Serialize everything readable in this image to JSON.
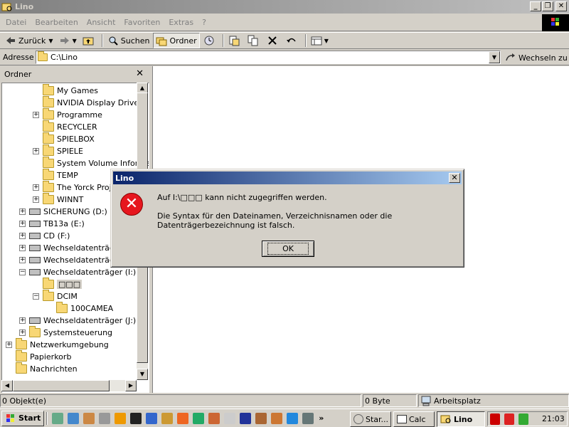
{
  "window": {
    "title": "Lino",
    "minimize": "_",
    "restore": "❐",
    "close": "✕"
  },
  "menu": [
    "Datei",
    "Bearbeiten",
    "Ansicht",
    "Favoriten",
    "Extras",
    "?"
  ],
  "toolbar": {
    "back": "Zurück",
    "search": "Suchen",
    "folders": "Ordner"
  },
  "address": {
    "label": "Adresse",
    "value": "C:\\Lino",
    "go": "Wechseln zu"
  },
  "folder_pane": {
    "title": "Ordner",
    "items": [
      {
        "label": "My Games",
        "expander": ""
      },
      {
        "label": "NVIDIA Display Driver",
        "expander": ""
      },
      {
        "label": "Programme",
        "expander": "+"
      },
      {
        "label": "RECYCLER",
        "expander": ""
      },
      {
        "label": "SPIELBOX",
        "expander": ""
      },
      {
        "label": "SPIELE",
        "expander": "+"
      },
      {
        "label": "System Volume Informa",
        "expander": ""
      },
      {
        "label": "TEMP",
        "expander": ""
      },
      {
        "label": "The Yorck Proje",
        "expander": "+"
      },
      {
        "label": "WINNT",
        "expander": "+"
      },
      {
        "label": "SICHERUNG (D:)",
        "expander": "+"
      },
      {
        "label": "TB13a (E:)",
        "expander": "+"
      },
      {
        "label": "CD (F:)",
        "expander": "+"
      },
      {
        "label": "Wechseldatenträge",
        "expander": "+"
      },
      {
        "label": "Wechseldatenträge",
        "expander": "+"
      },
      {
        "label": "Wechseldatenträger (I:)",
        "expander": "−"
      },
      {
        "label": "□□□",
        "expander": ""
      },
      {
        "label": "DCIM",
        "expander": "−"
      },
      {
        "label": "100CAMEA",
        "expander": ""
      },
      {
        "label": "Wechseldatenträger (J:)",
        "expander": "+"
      },
      {
        "label": "Systemsteuerung",
        "expander": "+"
      },
      {
        "label": "Netzwerkumgebung",
        "expander": "+"
      },
      {
        "label": "Papierkorb",
        "expander": ""
      },
      {
        "label": "Nachrichten",
        "expander": ""
      }
    ]
  },
  "status": {
    "objects": "0 Objekt(e)",
    "size": "0 Byte",
    "location": "Arbeitsplatz"
  },
  "taskbar": {
    "start": "Start",
    "tasks": [
      "Star...",
      "Calc",
      "Lino"
    ],
    "clock": "21:03"
  },
  "dialog": {
    "title": "Lino",
    "message": "Auf I:\\□□□ kann nicht zugegriffen werden.",
    "detail": "Die Syntax für den Dateinamen, Verzeichnisnamen oder die Datenträgerbezeichnung ist falsch.",
    "ok": "OK",
    "close": "✕"
  }
}
